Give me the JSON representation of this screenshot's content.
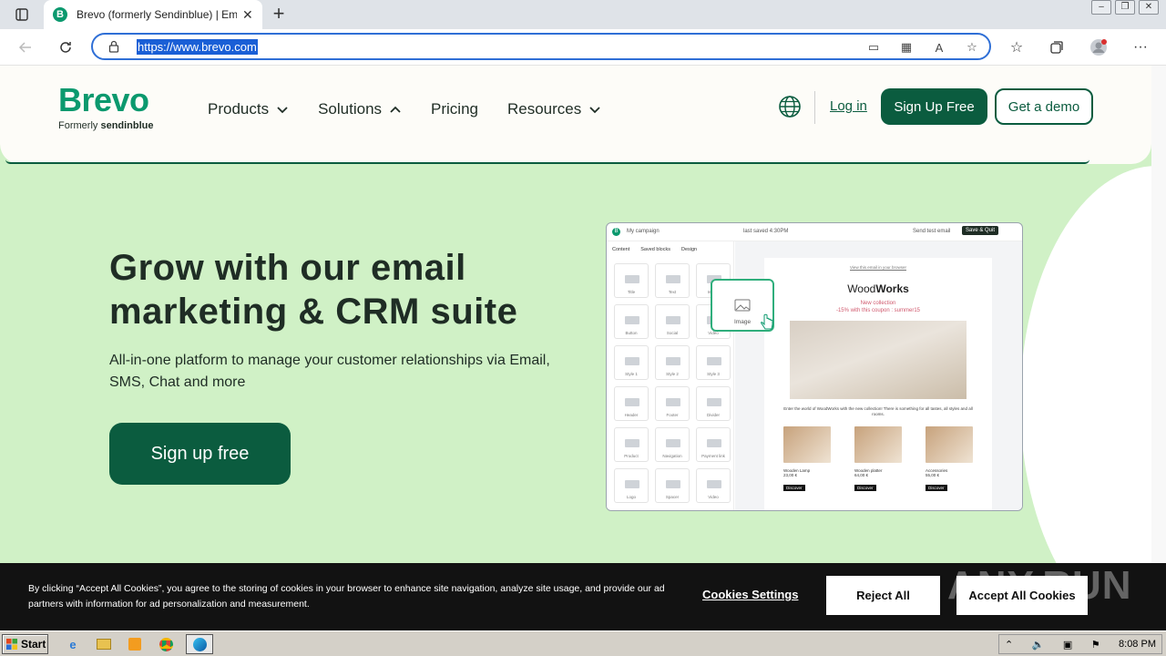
{
  "browser": {
    "tab_title": "Brevo (formerly Sendinblue) | Em",
    "favicon_letter": "B",
    "url": "https://www.brevo.com",
    "new_tab_symbol": "+",
    "tab_close_symbol": "✕"
  },
  "header": {
    "logo_word": "Brevo",
    "logo_formerly": "Formerly",
    "logo_brand": "sendinblue",
    "nav": [
      {
        "label": "Products",
        "icon": "chevron-down-icon"
      },
      {
        "label": "Solutions",
        "icon": "chevron-up-icon"
      },
      {
        "label": "Pricing"
      },
      {
        "label": "Resources",
        "icon": "chevron-down-icon"
      }
    ],
    "login": "Log in",
    "signup": "Sign Up Free",
    "demo": "Get a demo"
  },
  "hero": {
    "title": "Grow with our email marketing & CRM suite",
    "subtitle": "All-in-one platform to manage your customer relationships via Email, SMS, Chat and more",
    "cta": "Sign up free"
  },
  "mockup": {
    "campaign": "My campaign",
    "saved": "last saved 4:30PM",
    "send_test": "Send test email",
    "save_quit": "Save & Quit",
    "tabs": [
      "Content",
      "Saved blocks",
      "Design"
    ],
    "blocks": [
      "Title",
      "Text",
      "Image",
      "Button",
      "Social",
      "Video",
      "Style 1",
      "Style 2",
      "Style 3",
      "Header",
      "Footer",
      "Divider",
      "Product",
      "Navigation",
      "Payment link",
      "Logo",
      "Spacer",
      "Video"
    ],
    "drag_label": "Image",
    "view_browser": "View this email in your browser",
    "brand_light": "Wood",
    "brand_bold": "Works",
    "promo1": "New collection",
    "promo2": "-15% with this coupon : summer15",
    "blurb": "Enter the world of WoodWorks with the new collection! There is something for all tastes, all styles and all rooms.",
    "products": [
      {
        "name": "Wooden Lamp",
        "price": "23,00 €",
        "button": "Discover"
      },
      {
        "name": "Wooden platter",
        "price": "64,00 €",
        "button": "Discover"
      },
      {
        "name": "Accessories",
        "price": "55,00 €",
        "button": "Discover"
      }
    ]
  },
  "cookie": {
    "text": "By clicking “Accept All Cookies”, you agree to the storing of cookies in your browser to enhance site navigation, analyze site usage, and provide our ad partners with information for ad personalization and measurement.",
    "settings": "Cookies Settings",
    "reject": "Reject All",
    "accept": "Accept All Cookies",
    "watermark": "ANY.RUN"
  },
  "taskbar": {
    "start": "Start",
    "clock": "8:08 PM"
  },
  "colors": {
    "brand_green": "#0b996e",
    "dark_green": "#0b5c3f",
    "hero_bg": "#d0f1c6"
  }
}
